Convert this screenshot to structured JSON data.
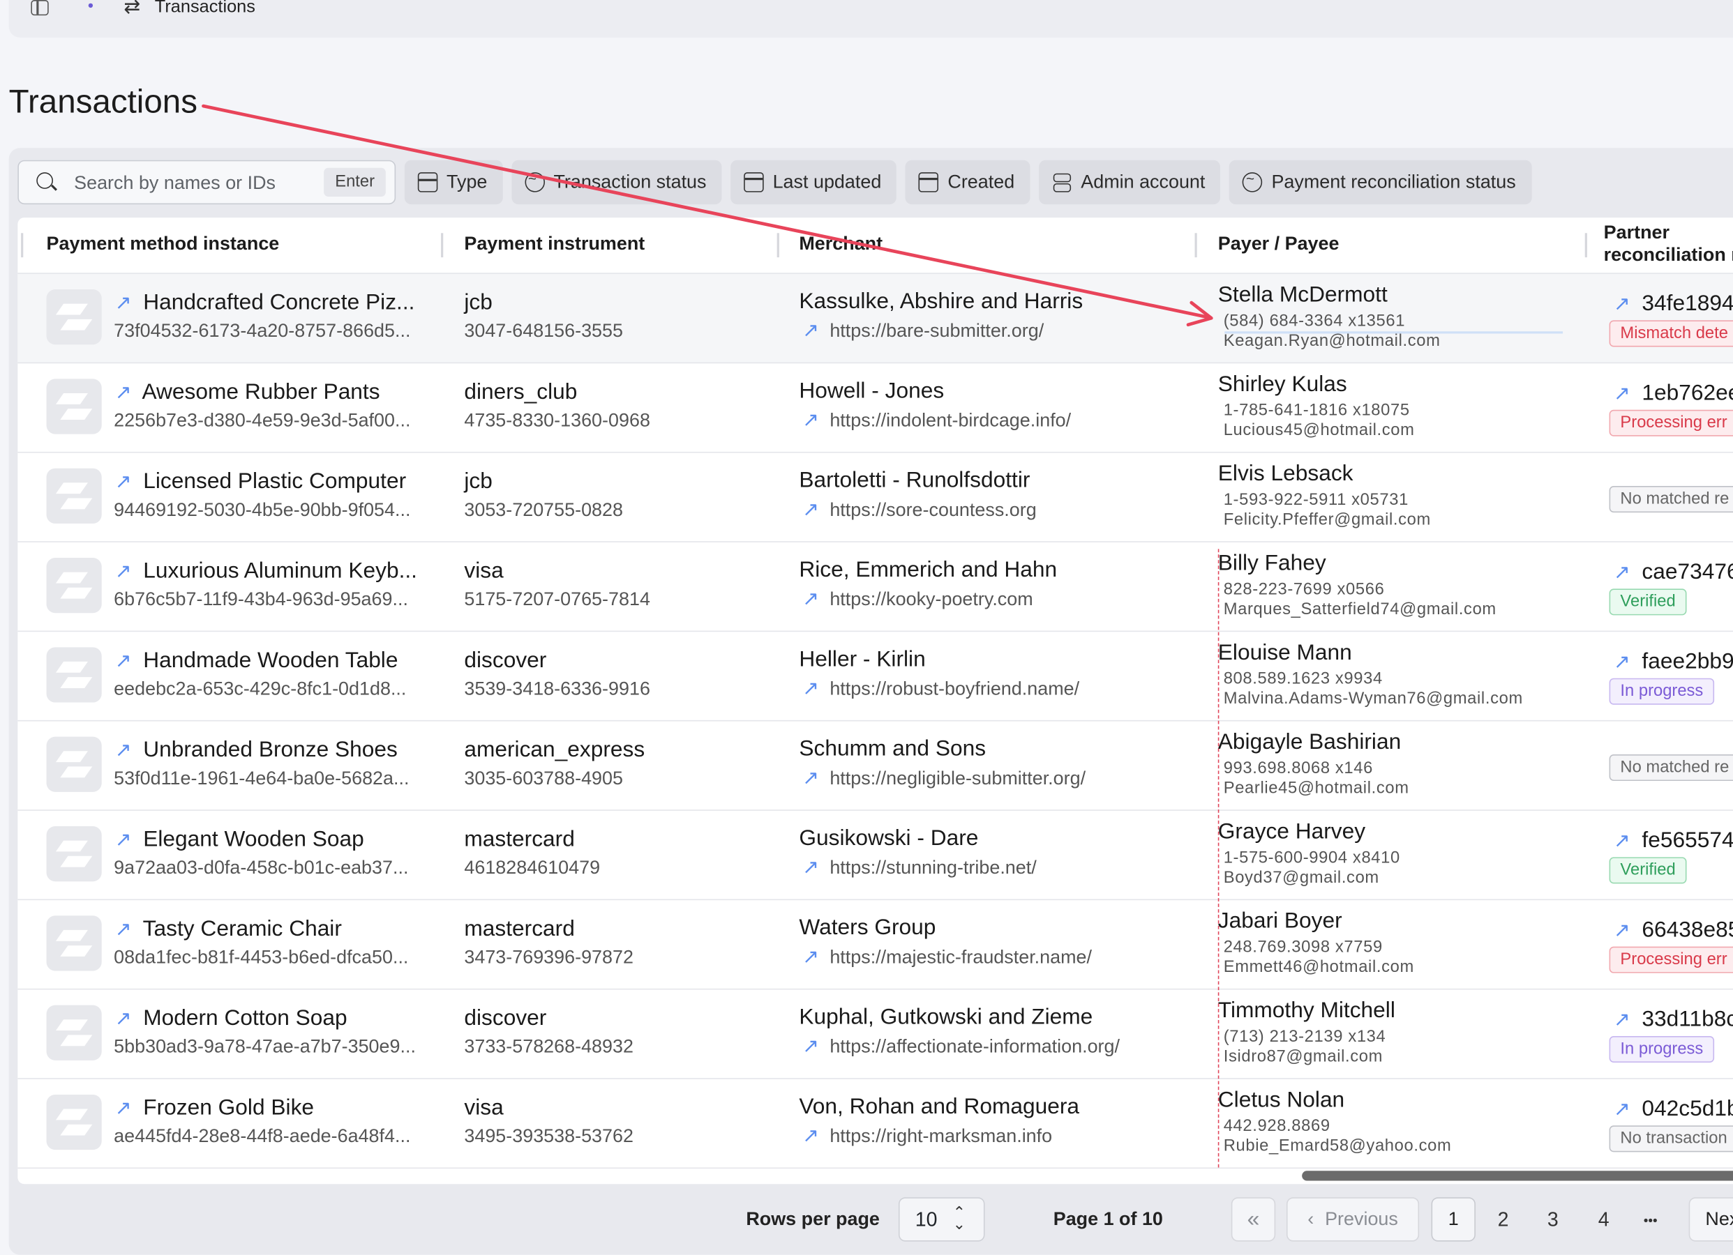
{
  "breadcrumb": {
    "title": "Transactions"
  },
  "page_title": "Transactions",
  "search": {
    "placeholder": "Search by names or IDs",
    "value": "",
    "enter_hint": "Enter"
  },
  "filters": [
    {
      "label": "Type",
      "icon": "type-icon"
    },
    {
      "label": "Transaction status",
      "icon": "status-icon"
    },
    {
      "label": "Last updated",
      "icon": "calendar-icon"
    },
    {
      "label": "Created",
      "icon": "calendar-icon"
    },
    {
      "label": "Admin account",
      "icon": "account-icon"
    },
    {
      "label": "Payment reconciliation status",
      "icon": "status-icon"
    }
  ],
  "columns": {
    "payment_method_instance": "Payment method instance",
    "payment_instrument": "Payment instrument",
    "merchant": "Merchant",
    "payer_payee": "Payer / Payee",
    "partner_reconciliation_1": "Partner",
    "partner_reconciliation_2": "reconciliation r"
  },
  "rows": [
    {
      "pm_name": "Handcrafted Concrete Piz...",
      "pm_id": "73f04532-6173-4a20-8757-866d5...",
      "pi_type": "jcb",
      "pi_num": "3047-648156-3555",
      "merchant": "Kassulke, Abshire and Harris",
      "url": "https://bare-submitter.org/",
      "payer": "Stella McDermott",
      "phone": "(584) 684-3364 x13561",
      "email": "Keagan.Ryan@hotmail.com",
      "rec_id": "34fe1894",
      "badge": "Mismatch dete"
    },
    {
      "pm_name": "Awesome Rubber Pants",
      "pm_id": "2256b7e3-d380-4e59-9e3d-5af00...",
      "pi_type": "diners_club",
      "pi_num": "4735-8330-1360-0968",
      "merchant": "Howell - Jones",
      "url": "https://indolent-birdcage.info/",
      "payer": "Shirley Kulas",
      "phone": "1-785-641-1816 x18075",
      "email": "Lucious45@hotmail.com",
      "rec_id": "1eb762ee",
      "badge": "Processing err"
    },
    {
      "pm_name": "Licensed Plastic Computer",
      "pm_id": "94469192-5030-4b5e-90bb-9f054...",
      "pi_type": "jcb",
      "pi_num": "3053-720755-0828",
      "merchant": "Bartoletti - Runolfsdottir",
      "url": "https://sore-countess.org",
      "payer": "Elvis Lebsack",
      "phone": "1-593-922-5911 x05731",
      "email": "Felicity.Pfeffer@gmail.com",
      "rec_id": "",
      "badge": "No matched re"
    },
    {
      "pm_name": "Luxurious Aluminum Keyb...",
      "pm_id": "6b76c5b7-11f9-43b4-963d-95a69...",
      "pi_type": "visa",
      "pi_num": "5175-7207-0765-7814",
      "merchant": "Rice, Emmerich and Hahn",
      "url": "https://kooky-poetry.com",
      "payer": "Billy Fahey",
      "phone": "828-223-7699 x0566",
      "email": "Marques_Satterfield74@gmail.com",
      "rec_id": "cae73476",
      "badge": "Verified"
    },
    {
      "pm_name": "Handmade Wooden Table",
      "pm_id": "eedebc2a-653c-429c-8fc1-0d1d8...",
      "pi_type": "discover",
      "pi_num": "3539-3418-6336-9916",
      "merchant": "Heller - Kirlin",
      "url": "https://robust-boyfriend.name/",
      "payer": "Elouise Mann",
      "phone": "808.589.1623 x9934",
      "email": "Malvina.Adams-Wyman76@gmail.com",
      "rec_id": "faee2bb9",
      "badge": "In progress"
    },
    {
      "pm_name": "Unbranded Bronze Shoes",
      "pm_id": "53f0d11e-1961-4e64-ba0e-5682a...",
      "pi_type": "american_express",
      "pi_num": "3035-603788-4905",
      "merchant": "Schumm and Sons",
      "url": "https://negligible-submitter.org/",
      "payer": "Abigayle Bashirian",
      "phone": "993.698.8068 x146",
      "email": "Pearlie45@hotmail.com",
      "rec_id": "",
      "badge": "No matched re"
    },
    {
      "pm_name": "Elegant Wooden Soap",
      "pm_id": "9a72aa03-d0fa-458c-b01c-eab37...",
      "pi_type": "mastercard",
      "pi_num": "4618284610479",
      "merchant": "Gusikowski - Dare",
      "url": "https://stunning-tribe.net/",
      "payer": "Grayce Harvey",
      "phone": "1-575-600-9904 x8410",
      "email": "Boyd37@gmail.com",
      "rec_id": "fe565574",
      "badge": "Verified"
    },
    {
      "pm_name": "Tasty Ceramic Chair",
      "pm_id": "08da1fec-b81f-4453-b6ed-dfca50...",
      "pi_type": "mastercard",
      "pi_num": "3473-769396-97872",
      "merchant": "Waters Group",
      "url": "https://majestic-fraudster.name/",
      "payer": "Jabari Boyer",
      "phone": "248.769.3098 x7759",
      "email": "Emmett46@hotmail.com",
      "rec_id": "66438e85",
      "badge": "Processing err"
    },
    {
      "pm_name": "Modern Cotton Soap",
      "pm_id": "5bb30ad3-9a78-47ae-a7b7-350e9...",
      "pi_type": "discover",
      "pi_num": "3733-578268-48932",
      "merchant": "Kuphal, Gutkowski and Zieme",
      "url": "https://affectionate-information.org/",
      "payer": "Timmothy Mitchell",
      "phone": "(713) 213-2139 x134",
      "email": "Isidro87@gmail.com",
      "rec_id": "33d11b8c",
      "badge": "In progress"
    },
    {
      "pm_name": "Frozen Gold Bike",
      "pm_id": "ae445fd4-28e8-44f8-aede-6a48f4...",
      "pi_type": "visa",
      "pi_num": "3495-393538-53762",
      "merchant": "Von, Rohan and Romaguera",
      "url": "https://right-marksman.info",
      "payer": "Cletus Nolan",
      "phone": "442.928.8869",
      "email": "Rubie_Emard58@yahoo.com",
      "rec_id": "042c5d1b",
      "badge": "No transaction"
    }
  ],
  "badge_colors": {
    "red": "#d93a4a",
    "green": "#2e9e5b",
    "purple": "#7b5bd6",
    "gray": "#666666"
  },
  "annotation_color": "#e8445a",
  "pagination": {
    "rows_per_page_label": "Rows per page",
    "rows_per_page_value": "10",
    "page_of": "Page 1 of 10",
    "first_icon": "«",
    "previous_label": "Previous",
    "pages": [
      "1",
      "2",
      "3",
      "4"
    ],
    "ellipsis": "•••",
    "next_label": "Nex"
  }
}
